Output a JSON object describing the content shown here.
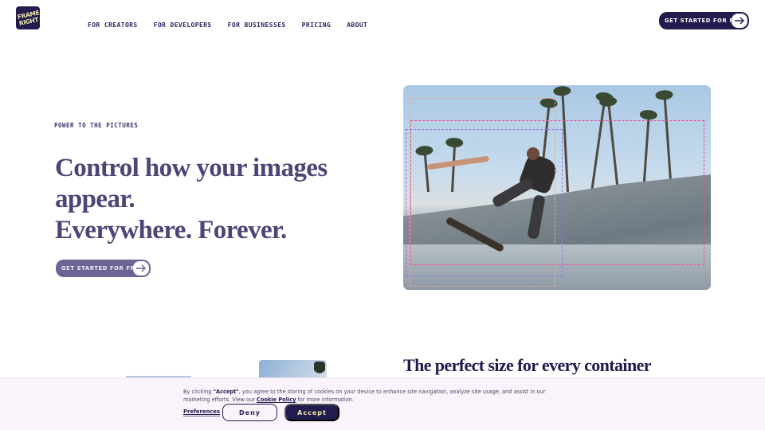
{
  "brand": {
    "logo_line1": "FRAME",
    "logo_line2": "RIGHT"
  },
  "nav": {
    "items": [
      {
        "label": "FOR CREATORS"
      },
      {
        "label": "FOR DEVELOPERS"
      },
      {
        "label": "FOR BUSINESSES"
      },
      {
        "label": "PRICING"
      },
      {
        "label": "ABOUT"
      }
    ],
    "cta_label": "GET STARTED FOR FREE"
  },
  "hero": {
    "eyebrow": "POWER TO THE PICTURES",
    "title_line1": "Control how your images appear.",
    "title_line2": "Everywhere. Forever.",
    "cta_label": "GET STARTED FOR FREE",
    "image_alt": "Skateboarder in a skate park under palm trees with dashed crop frames"
  },
  "section2": {
    "title": "The perfect size for every container"
  },
  "cookie": {
    "text_prefix": "By clicking ",
    "text_accept_word": "\"Accept\"",
    "text_middle": ", you agree to the storing of cookies on your device to enhance site navigation, analyze site usage, and assist in our marketing efforts. View our ",
    "policy_link": "Cookie Policy",
    "text_suffix": " for more information.",
    "preferences_label": "Preferences",
    "deny_label": "Deny",
    "accept_label": "Accept"
  },
  "colors": {
    "brand_navy": "#221c4e",
    "hero_button": "#6b6594",
    "accent_yellow": "#f2e6a8",
    "banner_bg": "#fbf3fb"
  }
}
